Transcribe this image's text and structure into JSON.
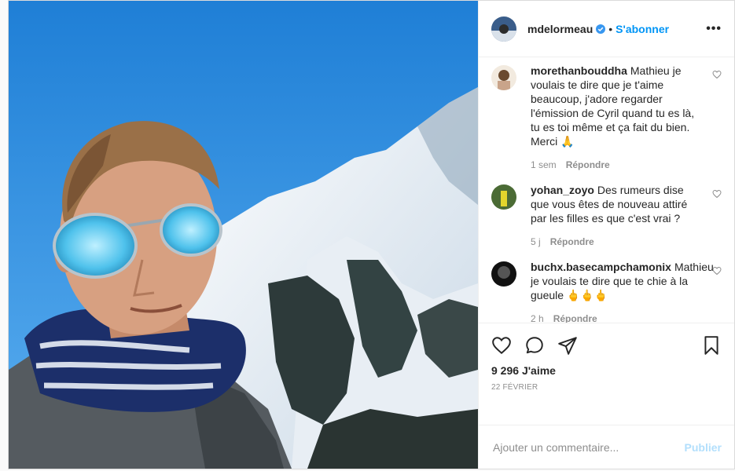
{
  "post": {
    "author": "mdelormeau",
    "follow_label": "S'abonner",
    "separator": "•",
    "more_label": "•••",
    "likes_count": "9 296",
    "likes_suffix": "J'aime",
    "date": "22 février",
    "comment_placeholder": "Ajouter un commentaire...",
    "publish_label": "Publier"
  },
  "comments": [
    {
      "user": "morethanbouddha",
      "text": "Mathieu je voulais te dire que je t'aime beaucoup, j'adore regarder l'émission de Cyril quand tu es là, tu es toi même et ça fait du bien. Merci 🙏",
      "time": "1 sem",
      "reply": "Répondre"
    },
    {
      "user": "yohan_zoyo",
      "text": "Des rumeurs dise que vous êtes de nouveau attiré par les filles es que c'est vrai ?",
      "time": "5 j",
      "reply": "Répondre"
    },
    {
      "user": "buchx.basecampchamonix",
      "text": "Mathieu je voulais te dire que te chie à la gueule 🖕🖕🖕",
      "time": "2 h",
      "reply": "Répondre"
    }
  ],
  "colors": {
    "accent": "#0095f6",
    "publish_disabled": "#b2dffc",
    "muted": "#8e8e8e",
    "text": "#262626"
  },
  "icons": [
    "verified-badge-icon",
    "more-options-icon",
    "heart-icon",
    "comment-icon",
    "share-icon",
    "bookmark-icon"
  ]
}
